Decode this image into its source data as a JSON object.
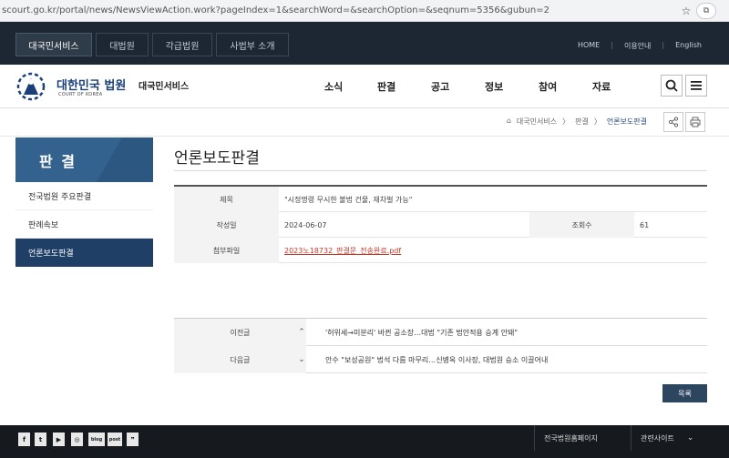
{
  "browser": {
    "url": "scourt.go.kr/portal/news/NewsViewAction.work?pageIndex=1&searchWord=&searchOption=&seqnum=5356&gubun=2",
    "star_icon": "star-icon",
    "ext_icon": "puzzle-icon"
  },
  "topbar": {
    "tabs": [
      "대국민서비스",
      "대법원",
      "각급법원",
      "사법부 소개"
    ],
    "links": [
      "HOME",
      "이용안내",
      "English"
    ]
  },
  "header": {
    "logo_title": "대한민국 법원",
    "logo_sub": "COURT OF KOREA",
    "service": "대국민서비스",
    "menu": [
      "소식",
      "판결",
      "공고",
      "정보",
      "참여",
      "자료"
    ]
  },
  "breadcrumb": {
    "home": "대국민서비스",
    "level1": "판결",
    "current": "언론보도판결"
  },
  "sidebar": {
    "title": "판 결",
    "items": [
      "전국법원 주요판결",
      "판례속보",
      "언론보도판결"
    ],
    "active_index": 2
  },
  "main": {
    "title": "언론보도판결",
    "labels": {
      "subject": "제목",
      "date": "작성일",
      "views": "조회수",
      "file": "첨부파일"
    },
    "subject": "\"시정명령 무시한 불법 건물, 재차벌 가능\"",
    "date": "2024-06-07",
    "views": "61",
    "file": "2023노18732_판결문_전송완료.pdf",
    "prev_label": "이전글",
    "prev_text": "'허위세→미분리' 바뀐 공소장…대법 \"기존 법안적용 승계 안돼\"",
    "next_label": "다음글",
    "next_text": "안수 \"보성공원\" 법석 다름 마무리…신병옥 이사장, 대법원 승소 이끌어내",
    "list_button": "목록"
  },
  "footer": {
    "sns": [
      "f",
      "t",
      "▶",
      "◎",
      "blog",
      "post",
      "❞"
    ],
    "selects": [
      "전국법원홈페이지",
      "관련사이트"
    ]
  },
  "colors": {
    "topbar": "#1c2733",
    "sidebar_title": "#34628f",
    "sidebar_active": "#1f3f66",
    "file_link": "#c0392b",
    "footer": "#16191d"
  }
}
